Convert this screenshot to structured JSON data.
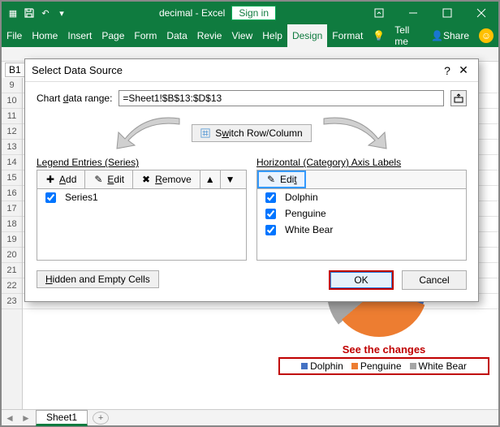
{
  "window": {
    "title_prefix": "decimal",
    "title_suffix": " - Excel",
    "signin": "Sign in"
  },
  "ribbon": {
    "tabs": [
      "File",
      "Home",
      "Insert",
      "Page",
      "Form",
      "Data",
      "Revie",
      "View",
      "Help",
      "Design",
      "Format"
    ],
    "active_index": 9,
    "tell_me": "Tell me",
    "share": "Share"
  },
  "namebox": "B1",
  "row_headers": [
    "9",
    "10",
    "11",
    "12",
    "13",
    "14",
    "15",
    "16",
    "17",
    "18",
    "19",
    "20",
    "21",
    "22",
    "23"
  ],
  "dialog": {
    "title": "Select Data Source",
    "chart_range_label": "Chart data range:",
    "chart_range_value": "=Sheet1!$B$13:$D$13",
    "switch": "Switch Row/Column",
    "legend_header": "Legend Entries (Series)",
    "axis_header": "Horizontal (Category) Axis Labels",
    "toolbar_add": "Add",
    "toolbar_edit": "Edit",
    "toolbar_remove": "Remove",
    "toolbar_edit2": "Edit",
    "series": [
      "Series1"
    ],
    "categories": [
      "Dolphin",
      "Penguine",
      "White Bear"
    ],
    "hidden_cells": "Hidden and Empty Cells",
    "ok": "OK",
    "cancel": "Cancel"
  },
  "callout": "See the changes",
  "legend": {
    "items": [
      "Dolphin",
      "Penguine",
      "White Bear"
    ],
    "colors": [
      "#4472c4",
      "#ed7d31",
      "#a5a5a5"
    ]
  },
  "sheet_tab": "Sheet1",
  "chart_data": {
    "type": "pie",
    "categories": [
      "Dolphin",
      "Penguine",
      "White Bear"
    ],
    "values": [
      1,
      1,
      1
    ],
    "title": "",
    "note": "Pie slices roughly equal; exact values not labeled in screenshot"
  }
}
